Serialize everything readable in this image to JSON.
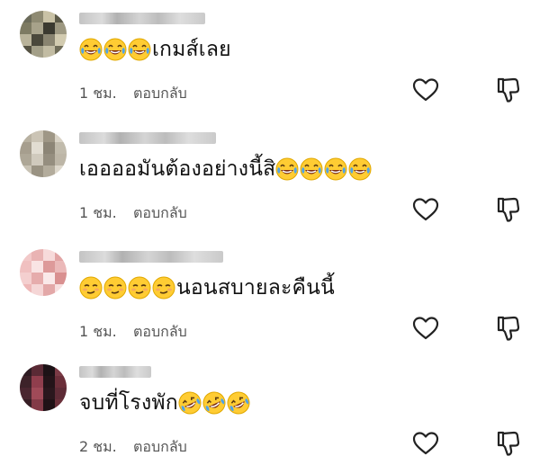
{
  "comments": [
    {
      "author": "",
      "text": "เกมส์เลย",
      "emojis_before": [
        "laugh-tears",
        "laugh-tears",
        "laugh-tears"
      ],
      "emojis_after": [],
      "time": "1 ชม.",
      "reply": "ตอบกลับ",
      "avatar_colors": [
        "#6b6b5a",
        "#8e8a72",
        "#c9c2a6",
        "#5c5a48",
        "#7d7a62",
        "#a7a28a",
        "#3b3a30",
        "#9d9881",
        "#b9b39a",
        "#4a483b",
        "#898470",
        "#d2cbb0",
        "#565343",
        "#a39f88",
        "#c2bca3",
        "#6f6c58"
      ],
      "name_width": 140
    },
    {
      "author": "",
      "text": "เออออมันต้องอย่างนี้สิ",
      "emojis_before": [],
      "emojis_after": [
        "laugh-tears",
        "laugh-tears",
        "laugh-tears",
        "laugh-tears"
      ],
      "time": "1 ชม.",
      "reply": "ตอบกลับ",
      "avatar_colors": [
        "#b8b1a1",
        "#cbc4b5",
        "#9f9786",
        "#d9d3c6",
        "#a69e8e",
        "#e2ddd2",
        "#8c8576",
        "#c1bbac",
        "#aea797",
        "#d0cabd",
        "#958e7f",
        "#bdb6a7",
        "#c8c2b4",
        "#9a9383",
        "#b3ac9c",
        "#ddd7cb"
      ],
      "name_width": 152
    },
    {
      "author": "",
      "text": "นอนสบายละคืนนี้",
      "emojis_before": [
        "smirk",
        "smirk",
        "smirk",
        "smirk"
      ],
      "emojis_after": [],
      "time": "1 ชม.",
      "reply": "ตอบกลับ",
      "avatar_colors": [
        "#f2c9c9",
        "#e9b3b3",
        "#f7dada",
        "#e2a4a4",
        "#f0c0c0",
        "#f9e4e4",
        "#dd9a9a",
        "#ebb9b9",
        "#f4cfcf",
        "#e6acac",
        "#fae9e9",
        "#d99090",
        "#eeb8b8",
        "#f5d6d6",
        "#e3a8a8",
        "#f8e0e0"
      ],
      "name_width": 160
    },
    {
      "author": "",
      "text": "จบที่โรงพัก",
      "emojis_before": [],
      "emojis_after": [
        "rofl",
        "rofl",
        "rofl"
      ],
      "time": "2 ชม.",
      "reply": "ตอบกลับ",
      "avatar_colors": [
        "#2e1b22",
        "#5a2a35",
        "#1c1216",
        "#7a3a45",
        "#3d2229",
        "#903e4d",
        "#241419",
        "#6b2f3a",
        "#4a2630",
        "#a04a58",
        "#2a171d",
        "#5e2b36",
        "#371e25",
        "#833a47",
        "#201216",
        "#6a303a"
      ],
      "name_width": 80
    }
  ]
}
